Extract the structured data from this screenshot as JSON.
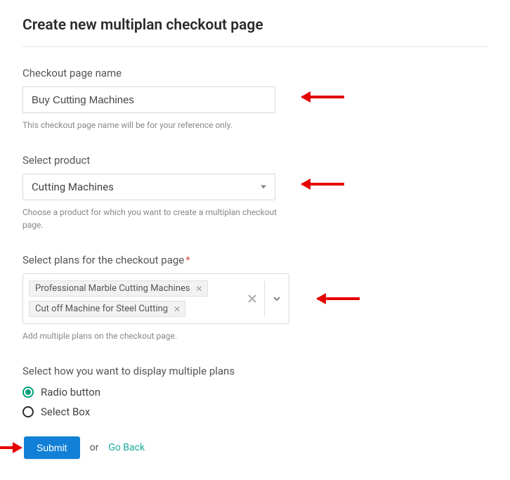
{
  "title": "Create new multiplan checkout page",
  "fields": {
    "name": {
      "label": "Checkout page name",
      "value": "Buy Cutting Machines",
      "help": "This checkout page name will be for your reference only."
    },
    "product": {
      "label": "Select product",
      "selected": "Cutting Machines",
      "help": "Choose a product for which you want to create a multiplan checkout page."
    },
    "plans": {
      "label": "Select plans for the checkout page",
      "tags": [
        "Professional Marble Cutting Machines",
        "Cut off Machine for Steel Cutting"
      ],
      "help": "Add multiple plans on the checkout page."
    },
    "display": {
      "label": "Select how you want to display multiple plans",
      "options": [
        "Radio button",
        "Select Box"
      ],
      "selected": "Radio button"
    }
  },
  "actions": {
    "submit": "Submit",
    "or": "or",
    "goback": "Go Back"
  }
}
